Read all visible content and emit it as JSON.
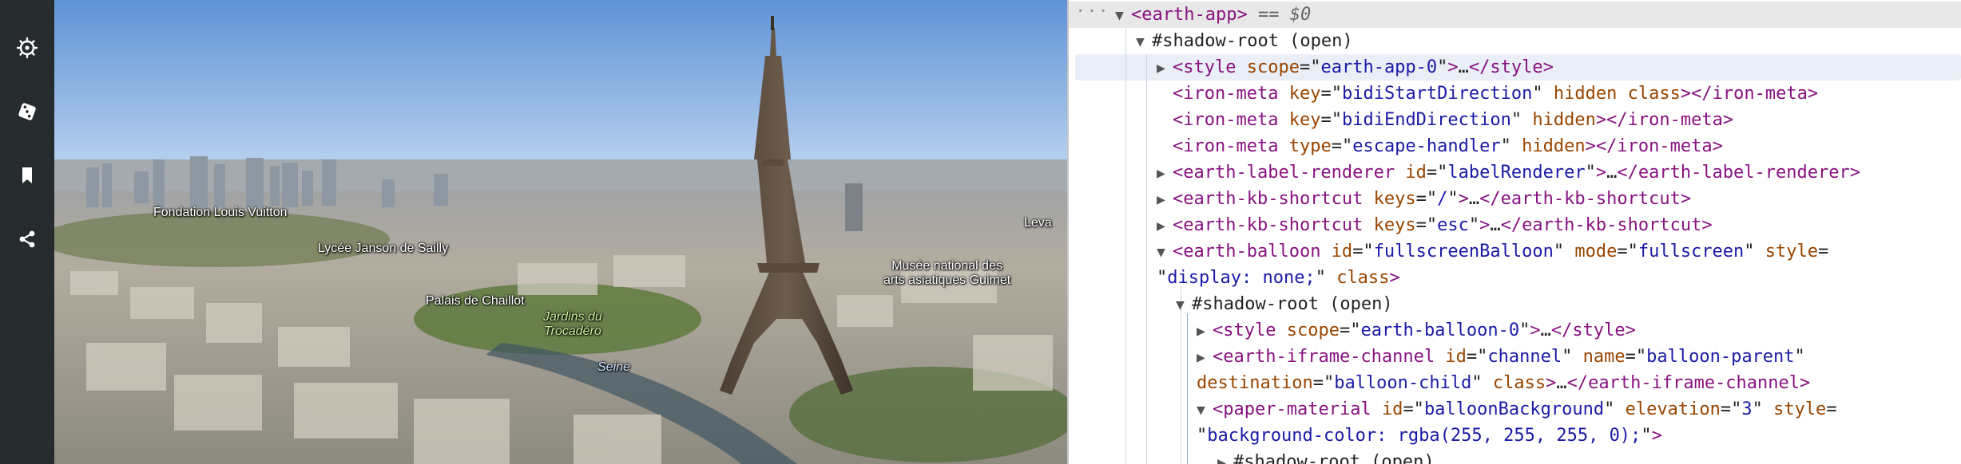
{
  "sidebar": {
    "items": [
      {
        "name": "voyager-icon",
        "label": "Voyager"
      },
      {
        "name": "dice-icon",
        "label": "I'm Feeling Lucky"
      },
      {
        "name": "bookmark-icon",
        "label": "Projects"
      },
      {
        "name": "share-icon",
        "label": "Share"
      }
    ]
  },
  "map": {
    "labels": {
      "fondation": "Fondation Louis Vuitton",
      "lycee": "Lycée Janson de Sailly",
      "musee_line1": "Musée national des",
      "musee_line2": "arts asiatiques Guimet",
      "chaillot": "Palais de Chaillot",
      "jardins_line1": "Jardins du",
      "jardins_line2": "Trocadéro",
      "seine": "Seine",
      "edge": "Leva"
    },
    "colors": {
      "sky_top": "#5f93d6",
      "sky_bottom": "#b9d1ef"
    }
  },
  "devtools": {
    "ellipsis": "···",
    "eq0": "== $0",
    "lines": {
      "l1_tag": "earth-app",
      "l2": "#shadow-root (open)",
      "l3_tag": "style",
      "l3_attr": "scope",
      "l3_val": "earth-app-0",
      "l4_attr1": "key",
      "l4_val1": "bidiStartDirection",
      "l4_attr2": "hidden",
      "l4_attr3": "class",
      "l5_attr1": "key",
      "l5_val1": "bidiEndDirection",
      "l5_attr2": "hidden",
      "l6_attr1": "type",
      "l6_val1": "escape-handler",
      "l6_attr2": "hidden",
      "iron_meta": "iron-meta",
      "l7_tag": "earth-label-renderer",
      "l7_attr": "id",
      "l7_val": "labelRenderer",
      "kb_tag": "earth-kb-shortcut",
      "kb_attr": "keys",
      "l8_val": "/",
      "l9_val": "esc",
      "l10_tag": "earth-balloon",
      "l10_attr1": "id",
      "l10_val1": "fullscreenBalloon",
      "l10_attr2": "mode",
      "l10_val2": "fullscreen",
      "l10_attr3": "style",
      "l11_val": "display: none;",
      "l11_attr": "class",
      "l12": "#shadow-root (open)",
      "l13_tag": "style",
      "l13_attr": "scope",
      "l13_val": "earth-balloon-0",
      "l14_tag": "earth-iframe-channel",
      "l14_attr1": "id",
      "l14_val1": "channel",
      "l14_attr2": "name",
      "l14_val2": "balloon-parent",
      "l15_attr1": "destination",
      "l15_val1": "balloon-child",
      "l15_attr2": "class",
      "l16_tag": "paper-material",
      "l16_attr1": "id",
      "l16_val1": "balloonBackground",
      "l16_attr2": "elevation",
      "l16_val2": "3",
      "l16_attr3": "style",
      "l17_val": "background-color: rgba(255, 255, 255, 0);",
      "l18": "#shadow-root (open)",
      "ellipsis_inline": "…"
    }
  }
}
